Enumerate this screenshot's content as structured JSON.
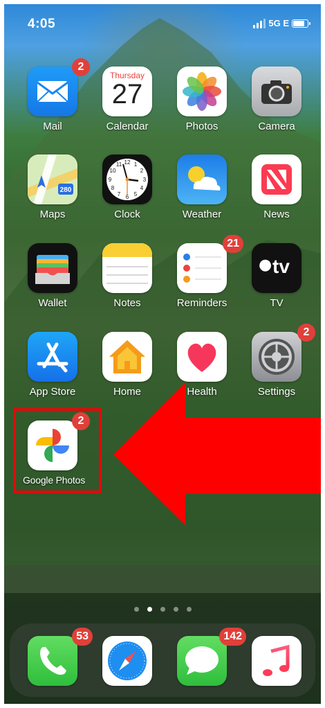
{
  "status_bar": {
    "time": "4:05",
    "network": "5G E"
  },
  "apps": {
    "mail": {
      "label": "Mail",
      "badge": "2"
    },
    "calendar": {
      "label": "Calendar",
      "weekday": "Thursday",
      "day": "27"
    },
    "photos": {
      "label": "Photos"
    },
    "camera": {
      "label": "Camera"
    },
    "maps": {
      "label": "Maps",
      "route": "280"
    },
    "clock": {
      "label": "Clock"
    },
    "weather": {
      "label": "Weather"
    },
    "news": {
      "label": "News"
    },
    "wallet": {
      "label": "Wallet"
    },
    "notes": {
      "label": "Notes"
    },
    "reminders": {
      "label": "Reminders",
      "badge": "21"
    },
    "tv": {
      "label": "TV",
      "icon_text": "tv"
    },
    "app_store": {
      "label": "App Store"
    },
    "home": {
      "label": "Home"
    },
    "health": {
      "label": "Health"
    },
    "settings": {
      "label": "Settings",
      "badge": "2"
    },
    "google_photos": {
      "label": "Google Photos",
      "badge": "2"
    }
  },
  "page_indicator": {
    "pages": 5,
    "current": 2
  },
  "dock": {
    "phone": {
      "badge": "53"
    },
    "safari": {},
    "messages": {
      "badge": "142"
    },
    "music": {}
  },
  "annotation": {
    "highlight_color": "#e00a0a",
    "arrow_color": "#ff0000"
  }
}
